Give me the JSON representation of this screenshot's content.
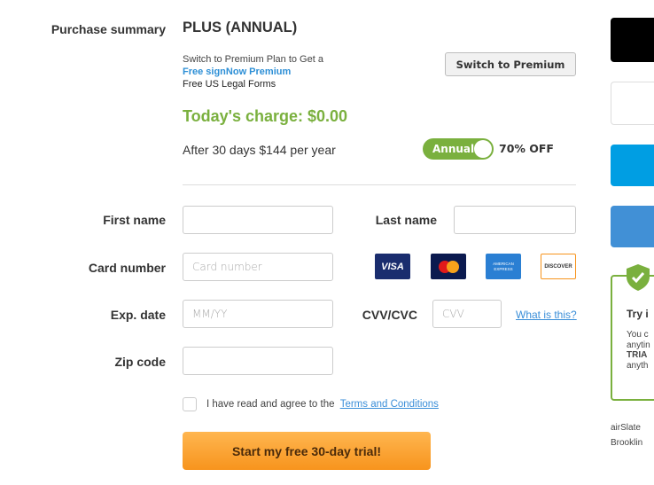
{
  "summary": {
    "label": "Purchase summary",
    "plan": "PLUS (ANNUAL)",
    "promo_line1": "Switch to Premium Plan to Get a",
    "promo_link": "Free signNow Premium",
    "promo_line3": "Free US Legal Forms",
    "switch_button": "Switch to Premium",
    "today_charge": "Today's charge: $0.00",
    "after_text": "After 30 days $144 per year",
    "toggle_label": "Annual",
    "toggle_on": true,
    "discount": "70% OFF"
  },
  "form": {
    "first_name_label": "First name",
    "last_name_label": "Last name",
    "card_number_label": "Card number",
    "card_number_placeholder": "Card number",
    "exp_label": "Exp. date",
    "exp_placeholder": "MM/YY",
    "cvv_label": "CVV/CVC",
    "cvv_placeholder": "CVV",
    "what_is_this": "What is this?",
    "zip_label": "Zip code",
    "agree_text": "I have read and agree to the",
    "terms_link": "Terms and Conditions",
    "submit": "Start my free 30-day trial!"
  },
  "cards": [
    "VISA",
    "MasterCard",
    "AMERICAN EXPRESS",
    "DISCOVER"
  ],
  "sidebar": {
    "trial_title": "Try i",
    "trial_lines": [
      "You c",
      "anytin",
      "TRIA",
      "anyth"
    ],
    "footer_line1": "airSlate",
    "footer_line2": "Brooklin"
  },
  "colors": {
    "green": "#7ab03e",
    "orange": "#f7941d",
    "link": "#3a8ed8"
  }
}
